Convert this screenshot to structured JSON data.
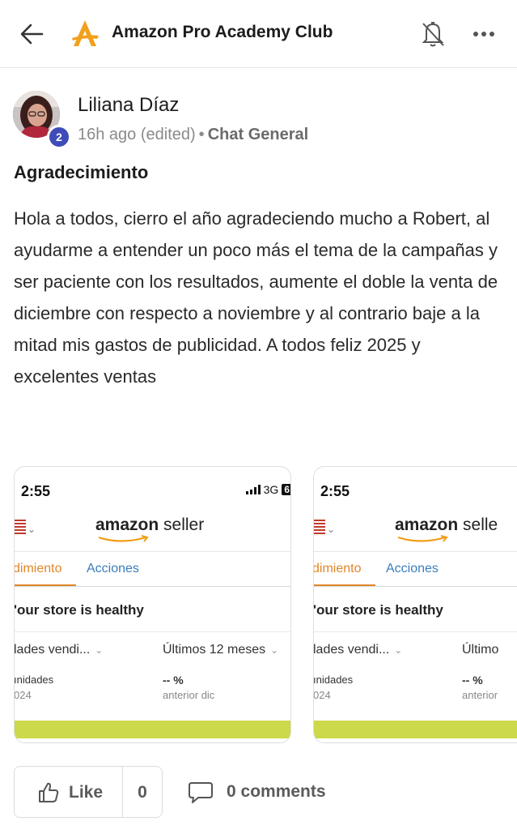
{
  "header": {
    "title": "Amazon Pro Academy Club",
    "icons": {
      "back": "arrow-left-icon",
      "logo": "academy-logo",
      "bell": "bell-muted-icon",
      "more": "more-horizontal-icon"
    },
    "accent_color": "#f2a01c"
  },
  "post": {
    "author": "Liliana Díaz",
    "level": "2",
    "time": "16h ago (edited)",
    "separator": "•",
    "channel": "Chat General",
    "title": "Agradecimiento",
    "body": "Hola a todos, cierro el año agradeciendo mucho a Robert, al ayudarme a entender un poco más el tema de la campañas y ser paciente con los resultados, aumente el doble la venta de diciembre con respecto a noviembre y al contrario baje a la mitad mis gastos de publicidad. A todos feliz 2025 y excelentes ventas"
  },
  "attachments": [
    {
      "time": "2:55",
      "network": "3G",
      "network_badge": "6",
      "brand_bold": "amazon",
      "brand_light": " seller",
      "tab_active": "dimiento",
      "tab_inactive": "Acciones",
      "health": "'our store is healthy",
      "dropdown_left": "lades vendi...",
      "dropdown_right": "Últimos 12 meses",
      "units_label": "ınidades",
      "units_year": "024",
      "percent": "-- %",
      "percent_caption": "anterior dic"
    },
    {
      "time": "2:55",
      "brand_bold": "amazon",
      "brand_light": " selle",
      "tab_active": "dimiento",
      "tab_inactive": "Acciones",
      "health": "'our store is healthy",
      "dropdown_left": "lades vendi...",
      "dropdown_right": "Último",
      "units_label": "ınidades",
      "units_year": "024",
      "percent": "-- %",
      "percent_caption": "anterior"
    }
  ],
  "actions": {
    "like_label": "Like",
    "like_count": "0",
    "comments_label": "0 comments",
    "icons": {
      "like": "thumbs-up-icon",
      "comment": "comment-bubble-icon"
    }
  },
  "colors": {
    "level_badge": "#3f4bb8",
    "tab_active": "#e0872a",
    "tab_inactive": "#3b7dbd",
    "health_bar": "#ccd94a"
  }
}
